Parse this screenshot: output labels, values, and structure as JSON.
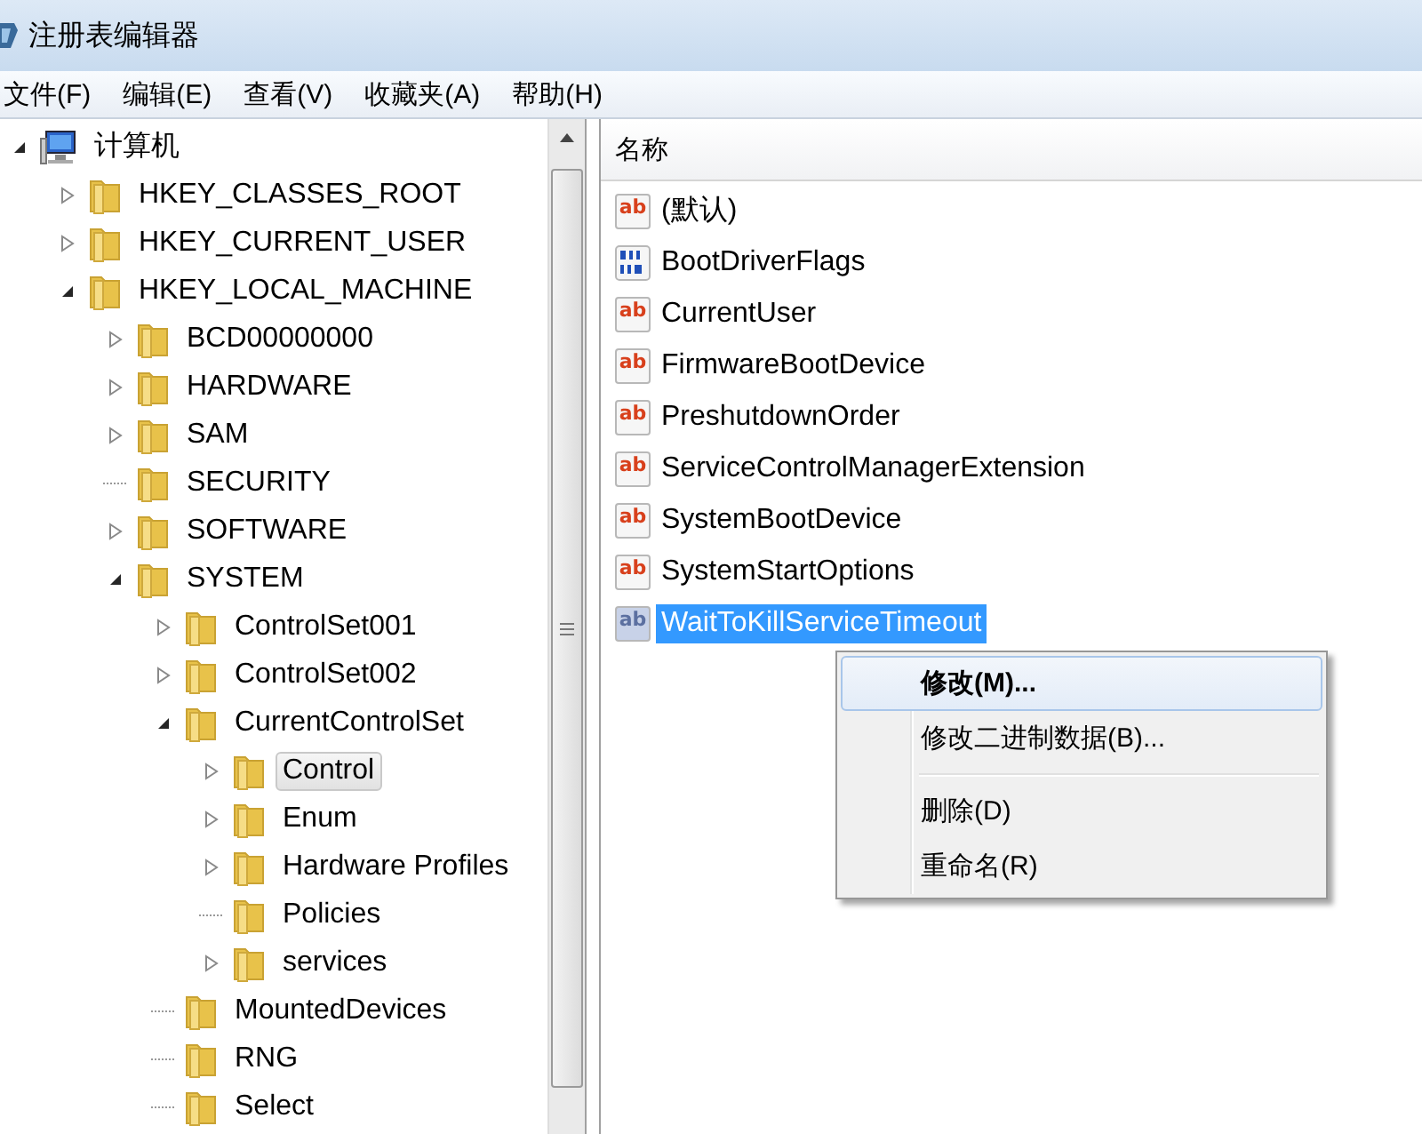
{
  "window": {
    "title": "注册表编辑器"
  },
  "menu_bar": [
    "文件(F)",
    "编辑(E)",
    "查看(V)",
    "收藏夹(A)",
    "帮助(H)"
  ],
  "tree": {
    "items": [
      {
        "label": "计算机",
        "kind": "node",
        "expanded": true,
        "selected": false,
        "children": [
          {
            "label": "HKEY_CLASSES_ROOT",
            "kind": "node",
            "expanded": false,
            "selected": false
          },
          {
            "label": "HKEY_CURRENT_USER",
            "kind": "node",
            "expanded": false,
            "selected": false
          },
          {
            "label": "HKEY_LOCAL_MACHINE",
            "kind": "node",
            "expanded": true,
            "selected": false,
            "children": [
              {
                "label": "BCD00000000",
                "kind": "node",
                "expanded": false,
                "selected": false
              },
              {
                "label": "HARDWARE",
                "kind": "node",
                "expanded": false,
                "selected": false
              },
              {
                "label": "SAM",
                "kind": "node",
                "expanded": false,
                "selected": false
              },
              {
                "label": "SECURITY",
                "kind": "leaf",
                "selected": false
              },
              {
                "label": "SOFTWARE",
                "kind": "node",
                "expanded": false,
                "selected": false
              },
              {
                "label": "SYSTEM",
                "kind": "node",
                "expanded": true,
                "selected": false,
                "children": [
                  {
                    "label": "ControlSet001",
                    "kind": "node",
                    "expanded": false,
                    "selected": false
                  },
                  {
                    "label": "ControlSet002",
                    "kind": "node",
                    "expanded": false,
                    "selected": false
                  },
                  {
                    "label": "CurrentControlSet",
                    "kind": "node",
                    "expanded": true,
                    "selected": false,
                    "children": [
                      {
                        "label": "Control",
                        "kind": "node",
                        "expanded": false,
                        "selected": true
                      },
                      {
                        "label": "Enum",
                        "kind": "node",
                        "expanded": false,
                        "selected": false
                      },
                      {
                        "label": "Hardware Profiles",
                        "kind": "node",
                        "expanded": false,
                        "selected": false
                      },
                      {
                        "label": "Policies",
                        "kind": "leaf",
                        "selected": false
                      },
                      {
                        "label": "services",
                        "kind": "node",
                        "expanded": false,
                        "selected": false
                      }
                    ]
                  },
                  {
                    "label": "MountedDevices",
                    "kind": "leaf",
                    "selected": false
                  },
                  {
                    "label": "RNG",
                    "kind": "leaf",
                    "selected": false
                  },
                  {
                    "label": "Select",
                    "kind": "leaf",
                    "selected": false
                  }
                ]
              }
            ]
          }
        ]
      }
    ]
  },
  "values": {
    "columns": [
      "名称"
    ],
    "rows": [
      {
        "kind": "string",
        "icon_text": "ab",
        "name": "(默认)",
        "selected": false
      },
      {
        "kind": "dword",
        "name": "BootDriverFlags",
        "selected": false
      },
      {
        "kind": "string",
        "icon_text": "ab",
        "name": "CurrentUser",
        "selected": false
      },
      {
        "kind": "string",
        "icon_text": "ab",
        "name": "FirmwareBootDevice",
        "selected": false
      },
      {
        "kind": "string",
        "icon_text": "ab",
        "name": "PreshutdownOrder",
        "selected": false
      },
      {
        "kind": "string",
        "icon_text": "ab",
        "name": "ServiceControlManagerExtension",
        "selected": false
      },
      {
        "kind": "string",
        "icon_text": "ab",
        "name": "SystemBootDevice",
        "selected": false
      },
      {
        "kind": "string",
        "icon_text": "ab",
        "name": "SystemStartOptions",
        "selected": false
      },
      {
        "kind": "string",
        "icon_text": "ab",
        "name": "WaitToKillServiceTimeout",
        "selected": true
      }
    ]
  },
  "context_menu": {
    "items": [
      {
        "kind": "item",
        "label": "修改(M)...",
        "default": true,
        "selected": true
      },
      {
        "kind": "item",
        "label": "修改二进制数据(B)...",
        "default": false,
        "selected": false
      },
      {
        "kind": "separator"
      },
      {
        "kind": "item",
        "label": "删除(D)",
        "default": false,
        "selected": false
      },
      {
        "kind": "item",
        "label": "重命名(R)",
        "default": false,
        "selected": false
      }
    ]
  }
}
